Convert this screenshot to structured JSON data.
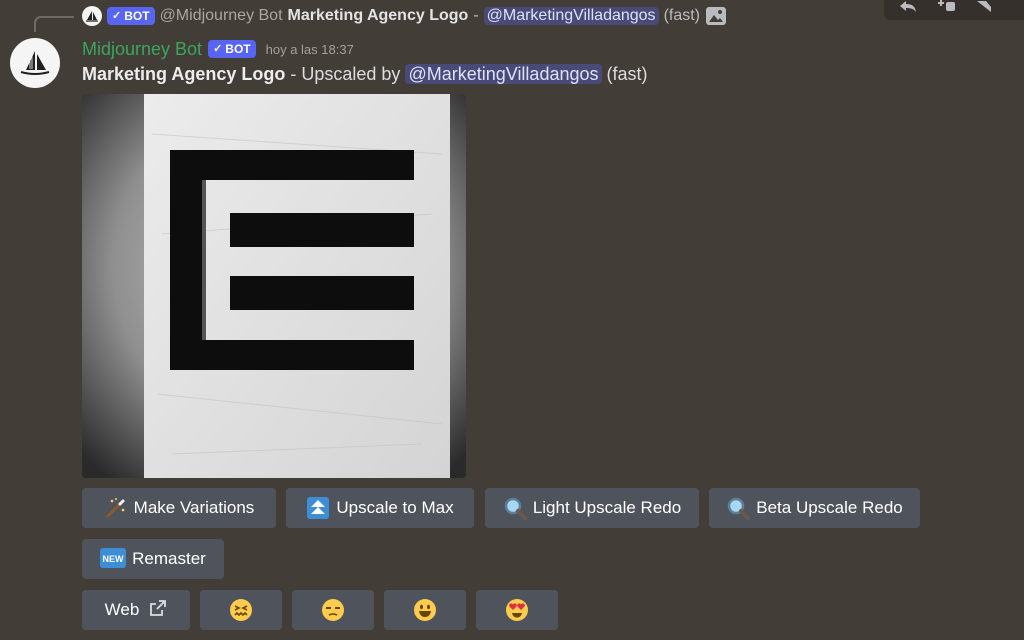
{
  "reply": {
    "author": "@Midjourney Bot",
    "bot_tag": "BOT",
    "content_title": "Marketing Agency Logo",
    "separator": "-",
    "mention": "@MarketingVilladangos",
    "mode": "(fast)"
  },
  "message": {
    "username": "Midjourney Bot",
    "bot_tag": "BOT",
    "timestamp": "hoy a las 18:37",
    "title": "Marketing Agency Logo",
    "upscaled_text": "- Upscaled by",
    "mention": "@MarketingVilladangos",
    "mode": "(fast)"
  },
  "buttons": {
    "make_variations": "Make Variations",
    "upscale_max": "Upscale to Max",
    "light_redo": "Light Upscale Redo",
    "beta_redo": "Beta Upscale Redo",
    "remaster": "Remaster",
    "new_badge": "NEW",
    "web": "Web"
  },
  "icons": {
    "toolbar": [
      "reply-icon",
      "add-reaction-icon",
      "more-icon"
    ],
    "make_variations": "magic-wand-icon",
    "upscale_max": "up-arrows-icon",
    "light_redo": "magnifier-icon",
    "beta_redo": "magnifier-icon",
    "remaster": "new-badge-icon",
    "web": "external-link-icon",
    "reactions": [
      "confounded-face-emoji",
      "unamused-face-emoji",
      "grinning-face-emoji",
      "heart-eyes-emoji"
    ]
  },
  "colors": {
    "background": "#433d38",
    "button": "#4f545c",
    "username": "#3ba55d",
    "bot_tag": "#5865f2"
  }
}
